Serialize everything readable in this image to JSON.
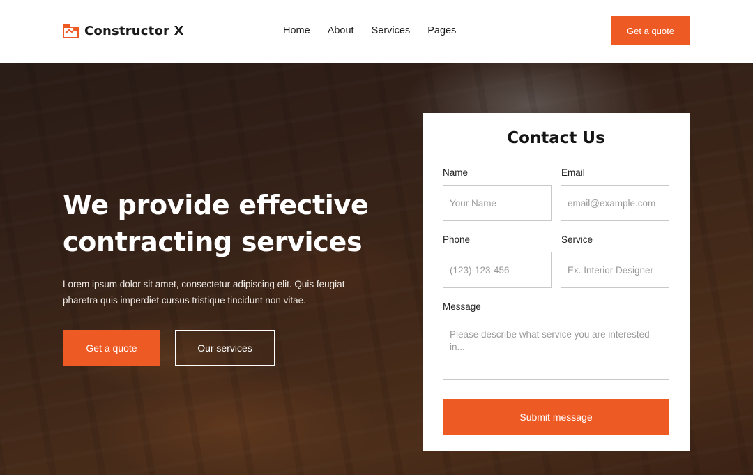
{
  "header": {
    "brand": "Constructor X",
    "logo_icon": "house-chart-icon",
    "nav": [
      {
        "label": "Home"
      },
      {
        "label": "About"
      },
      {
        "label": "Services"
      },
      {
        "label": "Pages"
      }
    ],
    "cta_label": "Get a quote"
  },
  "hero": {
    "title_line1": "We provide effective",
    "title_line2": "contracting services",
    "description": "Lorem ipsum dolor sit amet, consectetur adipiscing elit. Quis feugiat pharetra quis imperdiet cursus tristique tincidunt non vitae.",
    "primary_button": "Get a quote",
    "secondary_button": "Our services"
  },
  "contact": {
    "title": "Contact Us",
    "name_label": "Name",
    "name_placeholder": "Your Name",
    "email_label": "Email",
    "email_placeholder": "email@example.com",
    "phone_label": "Phone",
    "phone_placeholder": "(123)-123-456",
    "service_label": "Service",
    "service_placeholder": "Ex. Interior Designer",
    "message_label": "Message",
    "message_placeholder": "Please describe what service you are interested in...",
    "submit_label": "Submit message"
  },
  "colors": {
    "accent": "#ee5a24",
    "text_dark": "#1a1a1a",
    "white": "#ffffff"
  }
}
